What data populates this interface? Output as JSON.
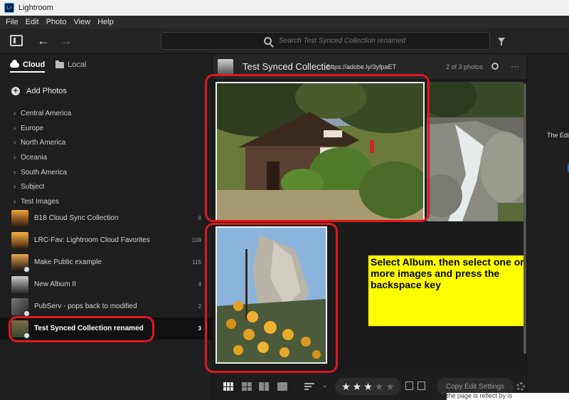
{
  "window": {
    "title": "Lightroom",
    "logo": "Lr"
  },
  "menu": [
    "File",
    "Edit",
    "Photo",
    "View",
    "Help"
  ],
  "toolbar": {
    "search_placeholder": "Search Test Synced Collection renamed",
    "icons": [
      "panel-toggle-icon",
      "back-arrow-icon",
      "forward-arrow-icon",
      "search-icon",
      "filter-icon"
    ]
  },
  "sidebar": {
    "tabs": [
      {
        "label": "Cloud",
        "active": true
      },
      {
        "label": "Local",
        "active": false
      }
    ],
    "add_photos": "Add Photos",
    "tree": [
      "Central America",
      "Europe",
      "North America",
      "Oceania",
      "South America",
      "Subject",
      "Test Images"
    ],
    "albums": [
      {
        "name": "B18 Cloud Sync Collection",
        "count": "8"
      },
      {
        "name": "LRC-Fav: Lightroom Cloud Favorites",
        "count": "109"
      },
      {
        "name": "Make Public example",
        "count": "115"
      },
      {
        "name": "New Album II",
        "count": "4"
      },
      {
        "name": "PubServ - pops back to modified",
        "count": "2"
      },
      {
        "name": "Test Synced Collection renamed",
        "count": "3",
        "selected": true
      }
    ]
  },
  "main": {
    "title": "Test Synced Collectic",
    "url": "https://adobe.ly/3yfpaET",
    "photo_count": "2 of 3 photos",
    "more": "···",
    "annotation": "Select Album.  then select one or more images and press the backspace key"
  },
  "bottombar": {
    "rating": 3,
    "max_rating": 5,
    "copy_label": "Copy Edit Settings"
  },
  "rightpanel": {
    "text": "The Edi"
  },
  "footer_text": "the page is reflect by is",
  "colors": {
    "accent": "#e0161f",
    "note_bg": "#ffff00",
    "brand": "#31a8ff"
  }
}
